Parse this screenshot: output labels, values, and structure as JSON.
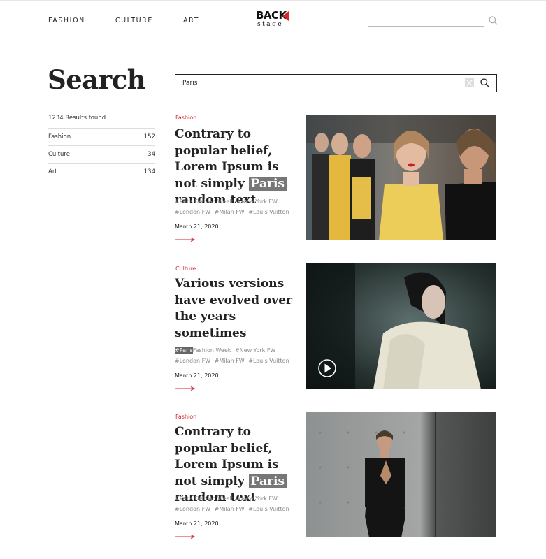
{
  "nav": {
    "items": [
      "FASHION",
      "CULTURE",
      "ART"
    ]
  },
  "logo": {
    "top": "BACK",
    "bottom": "stage"
  },
  "page": {
    "title": "Search"
  },
  "search": {
    "value": "Paris"
  },
  "sidebar": {
    "results_text": "1234 Results found",
    "filters": [
      {
        "label": "Fashion",
        "count": "152"
      },
      {
        "label": "Culture",
        "count": "34"
      },
      {
        "label": "Art",
        "count": "134"
      }
    ]
  },
  "articles": [
    {
      "category": "Fashion",
      "headline_before": "Contrary to popular belief, Lorem Ipsum is not simply",
      "headline_highlight": "Paris",
      "headline_after": "random text",
      "tags": [
        "#Paris Fashion Week",
        "#New York FW",
        "#London FW",
        "#Milan FW",
        "#Louis Vuitton"
      ],
      "date": "March 21, 2020",
      "has_video": false
    },
    {
      "category": "Culture",
      "headline_before": "Various versions have evolved over the years sometimes",
      "headline_highlight": "",
      "headline_after": "",
      "tag_highlight": "#Paris",
      "tag_first_rest": "Fashion Week",
      "tags": [
        "#New York FW",
        "#London FW",
        "#Milan FW",
        "#Louis Vuitton"
      ],
      "date": "March 21, 2020",
      "has_video": true
    },
    {
      "category": "Fashion",
      "headline_before": "Contrary to popular belief, Lorem Ipsum is not simply",
      "headline_highlight": "Paris",
      "headline_after": "random text",
      "tags": [
        "#Paris Fashion Week",
        "#New York FW",
        "#London FW",
        "#Milan FW",
        "#Louis Vuitton"
      ],
      "date": "March 21, 2020",
      "has_video": false
    }
  ],
  "colors": {
    "accent": "#d6262b",
    "highlight": "#777777",
    "text": "#222222",
    "muted": "#8a8a8a"
  },
  "icons": {
    "search": "search-icon",
    "clear": "clear-icon",
    "play": "play-icon",
    "arrow": "arrow-right-icon"
  }
}
